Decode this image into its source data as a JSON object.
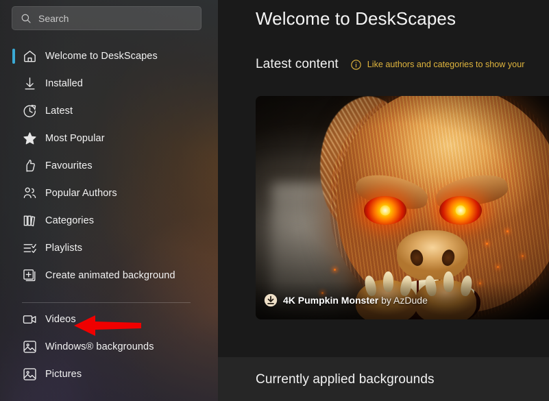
{
  "search": {
    "placeholder": "Search",
    "value": "",
    "icon": "search-icon"
  },
  "sidebar": {
    "items": [
      {
        "label": "Welcome to DeskScapes",
        "icon": "home-icon",
        "selected": true
      },
      {
        "label": "Installed",
        "icon": "download-arrow-icon",
        "selected": false
      },
      {
        "label": "Latest",
        "icon": "clock-history-icon",
        "selected": false
      },
      {
        "label": "Most Popular",
        "icon": "star-icon",
        "selected": false
      },
      {
        "label": "Favourites",
        "icon": "thumbs-up-icon",
        "selected": false
      },
      {
        "label": "Popular Authors",
        "icon": "people-icon",
        "selected": false
      },
      {
        "label": "Categories",
        "icon": "books-icon",
        "selected": false
      },
      {
        "label": "Playlists",
        "icon": "playlist-check-icon",
        "selected": false
      },
      {
        "label": "Create animated background",
        "icon": "plus-square-icon",
        "selected": false
      },
      {
        "label": "Videos",
        "icon": "video-camera-icon",
        "selected": false
      },
      {
        "label": "Windows® backgrounds",
        "icon": "picture-icon",
        "selected": false
      },
      {
        "label": "Pictures",
        "icon": "picture-icon",
        "selected": false
      }
    ],
    "divider_after_index": 8,
    "selection_accent_color": "#3aa9d4"
  },
  "annotation": {
    "type": "arrow",
    "points_to": "Videos",
    "color": "#f00000",
    "direction": "left"
  },
  "main": {
    "page_title": "Welcome to DeskScapes",
    "section": {
      "title": "Latest content",
      "info_icon": "info-circle-icon",
      "info_text": "Like authors and categories to show your",
      "info_color": "#e0b53d"
    },
    "hero_card": {
      "image_alt": "carved pumpkin monster with glowing orange eyes",
      "badge_icon": "download-circle-icon",
      "title": "4K Pumpkin Monster",
      "byline": "by AzDude"
    },
    "applied_section": {
      "title": "Currently applied backgrounds"
    }
  }
}
